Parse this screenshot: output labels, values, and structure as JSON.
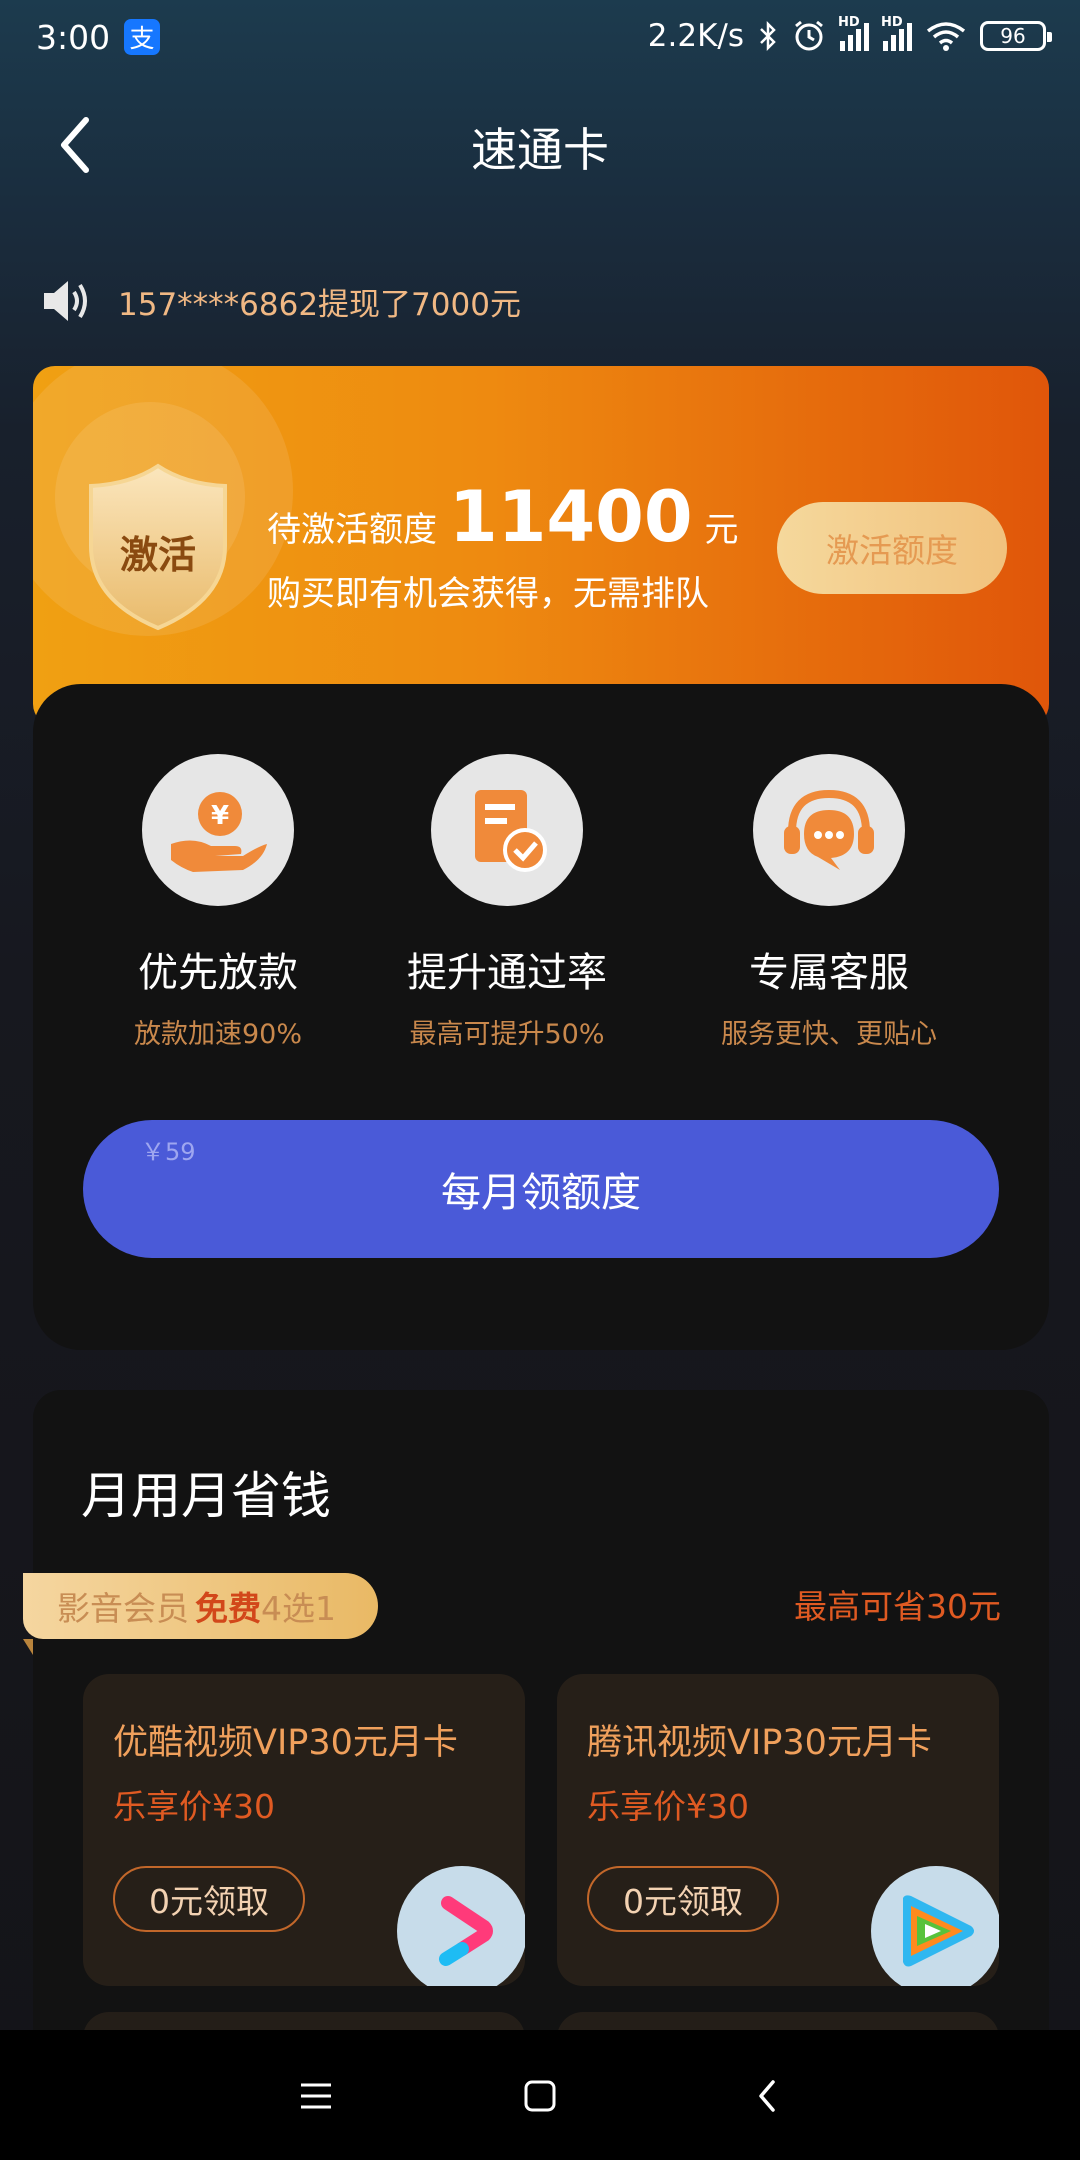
{
  "status_bar": {
    "time": "3:00",
    "alipay_glyph": "支",
    "net_speed": "2.2K/s",
    "hd": "HD",
    "battery": "96",
    "icons": [
      "alipay-icon",
      "bluetooth-icon",
      "alarm-icon",
      "signal-icon",
      "signal-icon",
      "wifi-icon",
      "battery-icon"
    ]
  },
  "header": {
    "title": "速通卡",
    "back_icon": "chevron-left-icon"
  },
  "notice": {
    "icon": "speaker-icon",
    "text": "157****6862提现了7000元"
  },
  "activation_card": {
    "shield_label": "激活",
    "quota_label": "待激活额度",
    "quota_amount": "11400",
    "quota_unit": "元",
    "subtitle": "购买即有机会获得，无需排队",
    "button_label": "激活额度"
  },
  "features": [
    {
      "icon": "hand-coin-icon",
      "title": "优先放款",
      "subtitle": "放款加速90%"
    },
    {
      "icon": "document-check-icon",
      "title": "提升通过率",
      "subtitle": "最高可提升50%"
    },
    {
      "icon": "headset-chat-icon",
      "title": "专属客服",
      "subtitle": "服务更快、更贴心"
    }
  ],
  "purchase": {
    "price": "￥59",
    "button_label": "每月领额度"
  },
  "savings": {
    "title": "月用月省钱",
    "badge_prefix": "影音会员 ",
    "badge_free": "免费",
    "badge_suffix": "4选1",
    "max_save": "最高可省30元",
    "cards": [
      {
        "name": "优酷视频VIP30元月卡",
        "price": "乐享价¥30",
        "claim": "0元领取",
        "logo": "youku-logo-icon"
      },
      {
        "name": "腾讯视频VIP30元月卡",
        "price": "乐享价¥30",
        "claim": "0元领取",
        "logo": "tencent-video-logo-icon"
      }
    ]
  },
  "nav_bar": {
    "icons": [
      "menu-icon",
      "home-square-icon",
      "back-icon"
    ]
  },
  "colors": {
    "accent_blue": "#4a5ad8",
    "orange": "#ee8a10",
    "price_red": "#e05a22",
    "gold": "#c9884c"
  }
}
